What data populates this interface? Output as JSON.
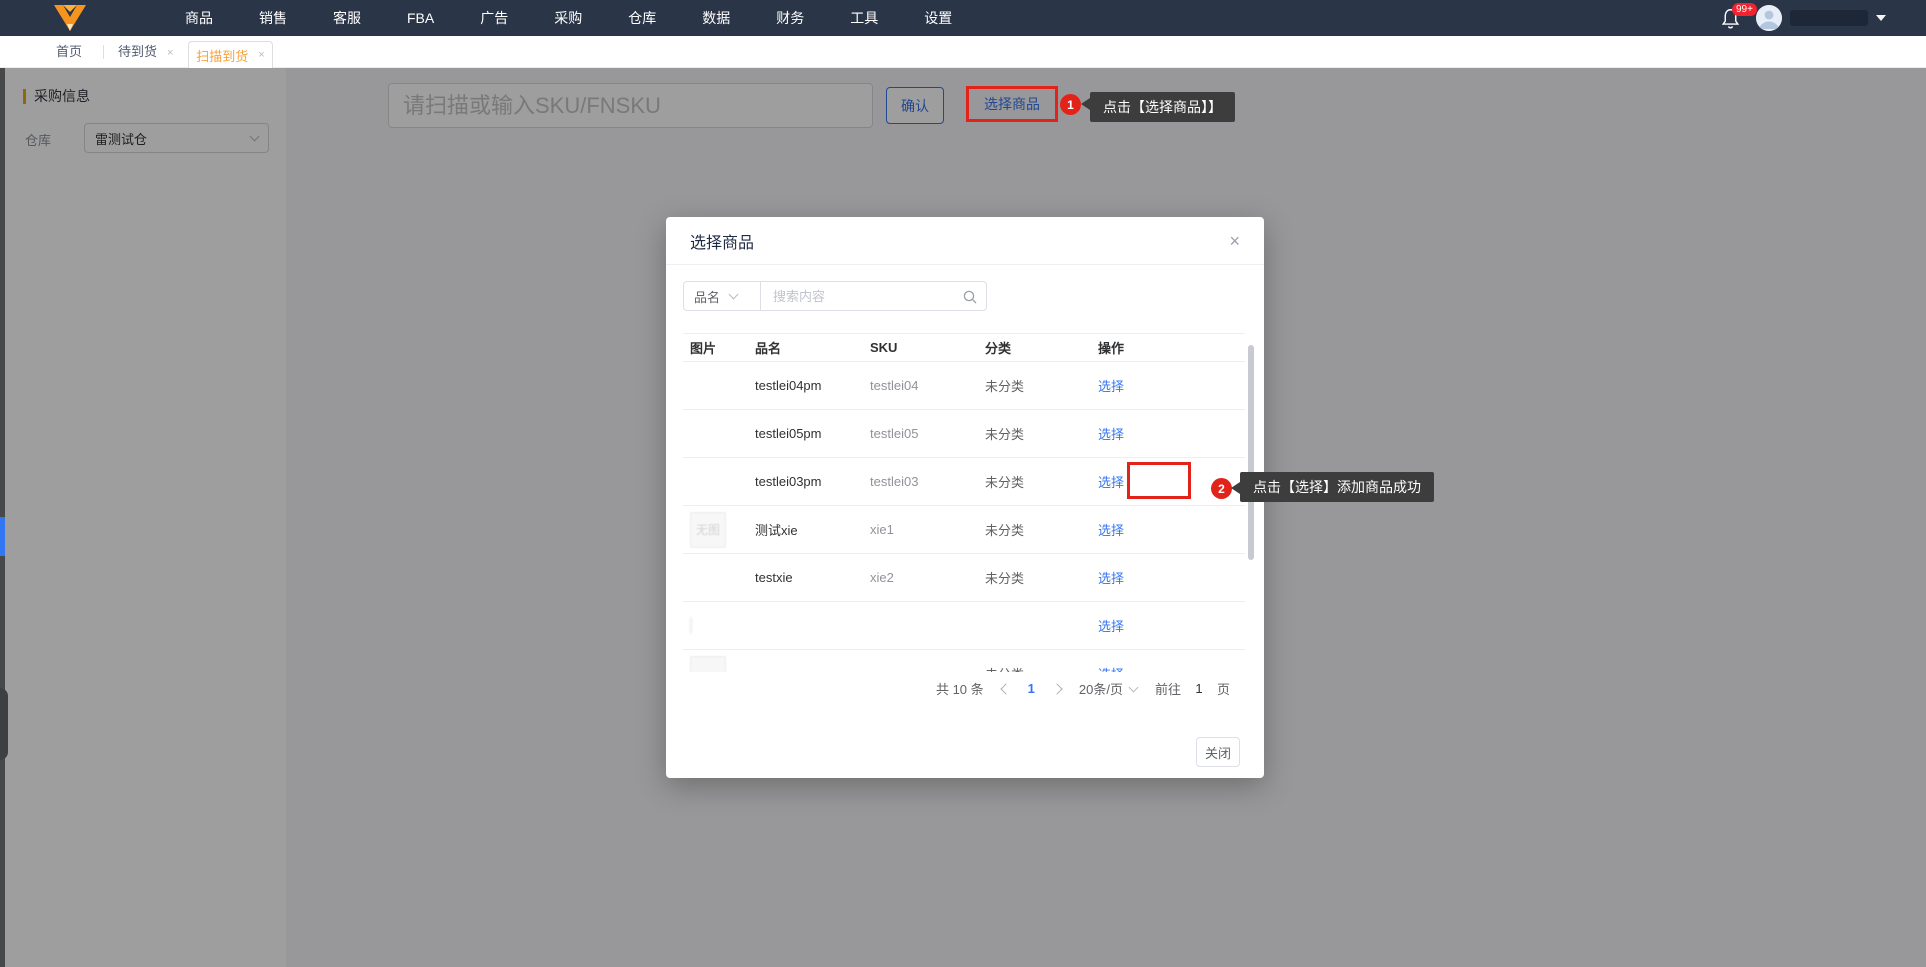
{
  "colors": {
    "nav_bg": "#2b3548",
    "accent_blue": "#3875ea",
    "active_tab_orange": "#f9a13a",
    "annotation_red": "#e2231a",
    "section_marker_orange": "#e6a817"
  },
  "nav": {
    "items": [
      "商品",
      "销售",
      "客服",
      "FBA",
      "广告",
      "采购",
      "仓库",
      "数据",
      "财务",
      "工具",
      "设置"
    ],
    "notification_badge": "99+"
  },
  "tabs": {
    "home": "首页",
    "pending_arrival": "待到货",
    "scan_arrival": "扫描到货",
    "close_glyph": "×"
  },
  "sidebar": {
    "section_title": "采购信息",
    "warehouse_label": "仓库",
    "warehouse_value": "雷测试仓"
  },
  "toolbar": {
    "scan_placeholder": "请扫描或输入SKU/FNSKU",
    "confirm_label": "确认",
    "select_product_label": "选择商品"
  },
  "annotations": {
    "step1_num": "1",
    "step1_text": "点击【选择商品】】",
    "step2_num": "2",
    "step2_text": "点击【选择】添加商品成功"
  },
  "modal": {
    "title": "选择商品",
    "close_glyph": "×",
    "search_field": "品名",
    "search_placeholder": "搜索内容",
    "headers": [
      "图片",
      "品名",
      "SKU",
      "分类",
      "操作"
    ],
    "action_label": "选择",
    "no_image_text": "无图",
    "rows": [
      {
        "name": "testlei04pm",
        "sku": "testlei04",
        "category": "未分类"
      },
      {
        "name": "testlei05pm",
        "sku": "testlei05",
        "category": "未分类"
      },
      {
        "name": "testlei03pm",
        "sku": "testlei03",
        "category": "未分类"
      },
      {
        "name": "测试xie",
        "sku": "xie1",
        "category": "未分类"
      },
      {
        "name": "testxie",
        "sku": "xie2",
        "category": "未分类"
      }
    ],
    "pagination": {
      "total": "共 10 条",
      "current_page": "1",
      "page_size": "20条/页",
      "goto_label": "前往",
      "goto_value": "1",
      "goto_unit": "页"
    },
    "close_label": "关闭"
  }
}
